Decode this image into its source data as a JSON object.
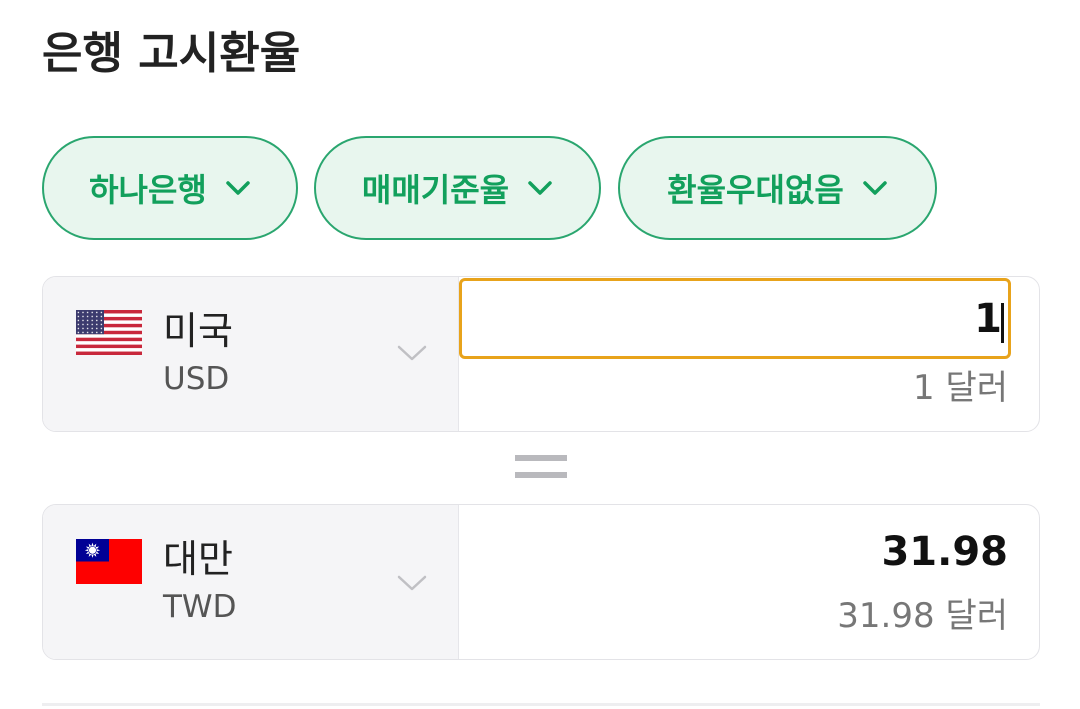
{
  "header": {
    "title": "은행 고시환율"
  },
  "filters": [
    {
      "label": "하나은행",
      "icon": "chevron-down-icon"
    },
    {
      "label": "매매기준율",
      "icon": "chevron-down-icon"
    },
    {
      "label": "환율우대없음",
      "icon": "chevron-down-icon"
    }
  ],
  "converter": {
    "from": {
      "flag_icon": "us-flag-icon",
      "country": "미국",
      "currency_code": "USD",
      "amount": "1",
      "amount_text": "1 달러",
      "dropdown_icon": "chevron-down-icon"
    },
    "equals_icon": "equals-icon",
    "to": {
      "flag_icon": "taiwan-flag-icon",
      "country": "대만",
      "currency_code": "TWD",
      "amount": "31.98",
      "amount_text": "31.98 달러",
      "dropdown_icon": "chevron-down-icon"
    }
  },
  "colors": {
    "accent_green": "#12a05c",
    "chip_border": "#2aa66f",
    "chip_background": "#e8f6ee",
    "input_focus_border": "#e8a31b",
    "text_primary": "#222222",
    "text_secondary": "#777777"
  }
}
